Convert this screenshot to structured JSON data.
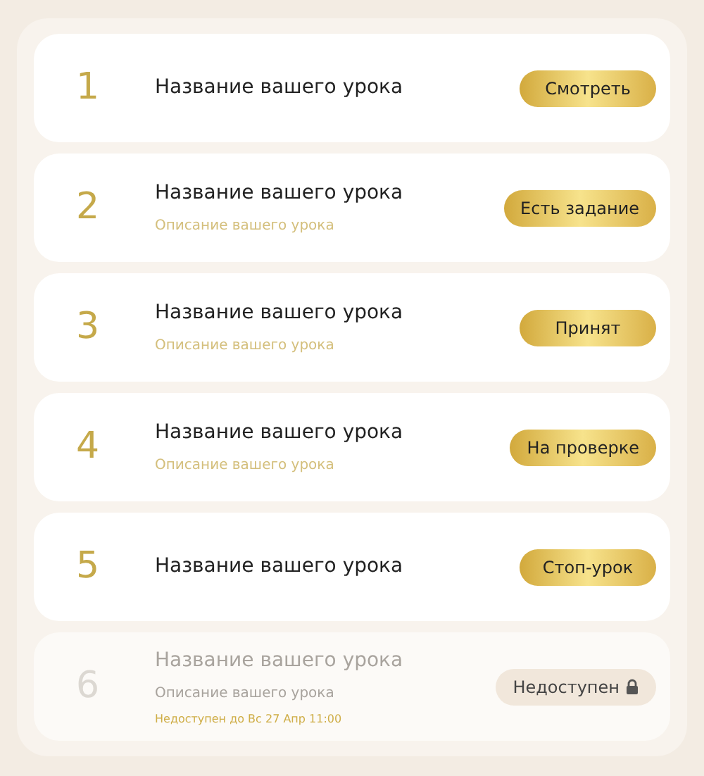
{
  "lessons": [
    {
      "number": "1",
      "title": "Название вашего урока",
      "action": "Смотреть",
      "locked": false
    },
    {
      "number": "2",
      "title": "Название вашего урока",
      "description": "Описание вашего урока",
      "action": "Есть задание",
      "locked": false
    },
    {
      "number": "3",
      "title": "Название вашего урока",
      "description": "Описание вашего урока",
      "action": "Принят",
      "locked": false
    },
    {
      "number": "4",
      "title": "Название вашего урока",
      "description": "Описание вашего урока",
      "action": "На проверке",
      "locked": false
    },
    {
      "number": "5",
      "title": "Название вашего урока",
      "action": "Стоп-урок",
      "locked": false
    },
    {
      "number": "6",
      "title": "Название вашего урока",
      "description": "Описание вашего урока",
      "note": "Недоступен до Вс 27 Апр 11:00",
      "action": "Недоступен",
      "locked": true
    }
  ]
}
